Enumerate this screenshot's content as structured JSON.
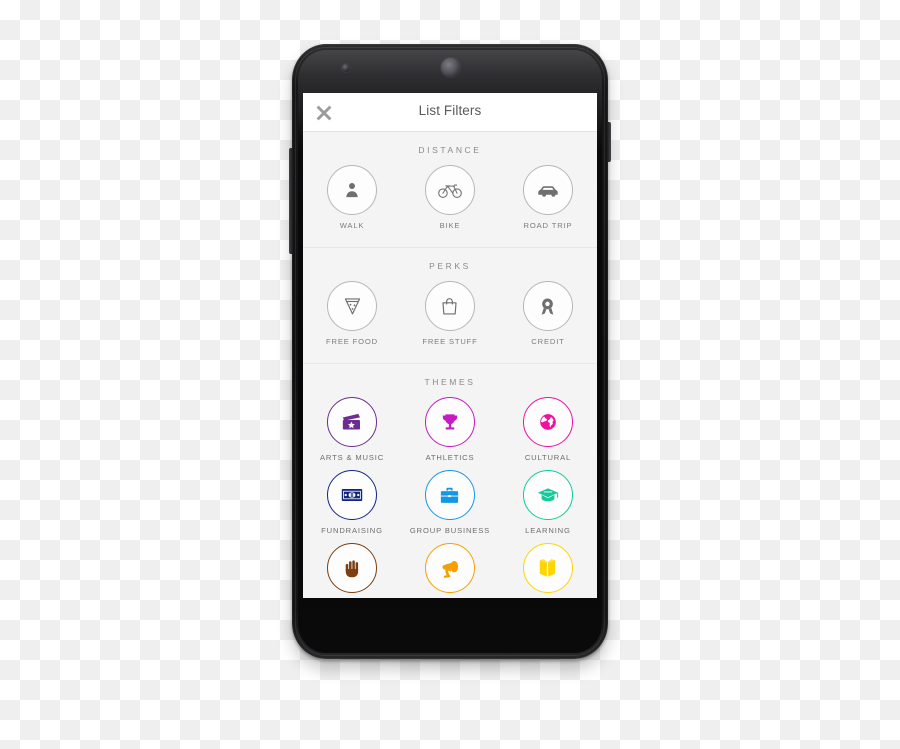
{
  "app": {
    "header": {
      "title": "List Filters",
      "close_icon": "close-icon"
    }
  },
  "sections": [
    {
      "id": "distance",
      "title": "DISTANCE",
      "items": [
        {
          "label": "WALK",
          "icon": "person-icon",
          "color": "#6f6f6f",
          "ring": "#b7b7b7"
        },
        {
          "label": "BIKE",
          "icon": "bicycle-icon",
          "color": "#6f6f6f",
          "ring": "#b7b7b7"
        },
        {
          "label": "ROAD TRIP",
          "icon": "car-icon",
          "color": "#6f6f6f",
          "ring": "#b7b7b7"
        }
      ]
    },
    {
      "id": "perks",
      "title": "PERKS",
      "items": [
        {
          "label": "FREE FOOD",
          "icon": "pizza-slice-icon",
          "color": "#6f6f6f",
          "ring": "#b7b7b7"
        },
        {
          "label": "FREE STUFF",
          "icon": "shopping-bag-icon",
          "color": "#6f6f6f",
          "ring": "#b7b7b7"
        },
        {
          "label": "CREDIT",
          "icon": "award-ribbon-icon",
          "color": "#6f6f6f",
          "ring": "#b7b7b7"
        }
      ]
    },
    {
      "id": "themes",
      "title": "THEMES",
      "items": [
        {
          "label": "ARTS & MUSIC",
          "icon": "clapperboard-star-icon",
          "color": "#6b2d8f",
          "ring": "#6b2d8f"
        },
        {
          "label": "ATHLETICS",
          "icon": "trophy-icon",
          "color": "#c41bc4",
          "ring": "#c41bc4"
        },
        {
          "label": "CULTURAL",
          "icon": "globe-icon",
          "color": "#f0119e",
          "ring": "#f0119e"
        },
        {
          "label": "FUNDRAISING",
          "icon": "money-bill-icon",
          "color": "#13277f",
          "ring": "#13277f"
        },
        {
          "label": "GROUP BUSINESS",
          "icon": "briefcase-icon",
          "color": "#1597e8",
          "ring": "#1597e8"
        },
        {
          "label": "LEARNING",
          "icon": "graduation-cap-icon",
          "color": "#14c99a",
          "ring": "#14c99a"
        },
        {
          "label": "",
          "icon": "raised-hand-icon",
          "color": "#7b3f10",
          "ring": "#7b3f10"
        },
        {
          "label": "",
          "icon": "megaphone-icon",
          "color": "#f5a000",
          "ring": "#f5a000"
        },
        {
          "label": "",
          "icon": "open-book-icon",
          "color": "#ffd500",
          "ring": "#ffd500"
        }
      ]
    }
  ],
  "device": {
    "camera": "front-camera",
    "earpiece": "earpiece-speaker",
    "volume_button": "volume-rocker",
    "power_button": "power-button"
  }
}
